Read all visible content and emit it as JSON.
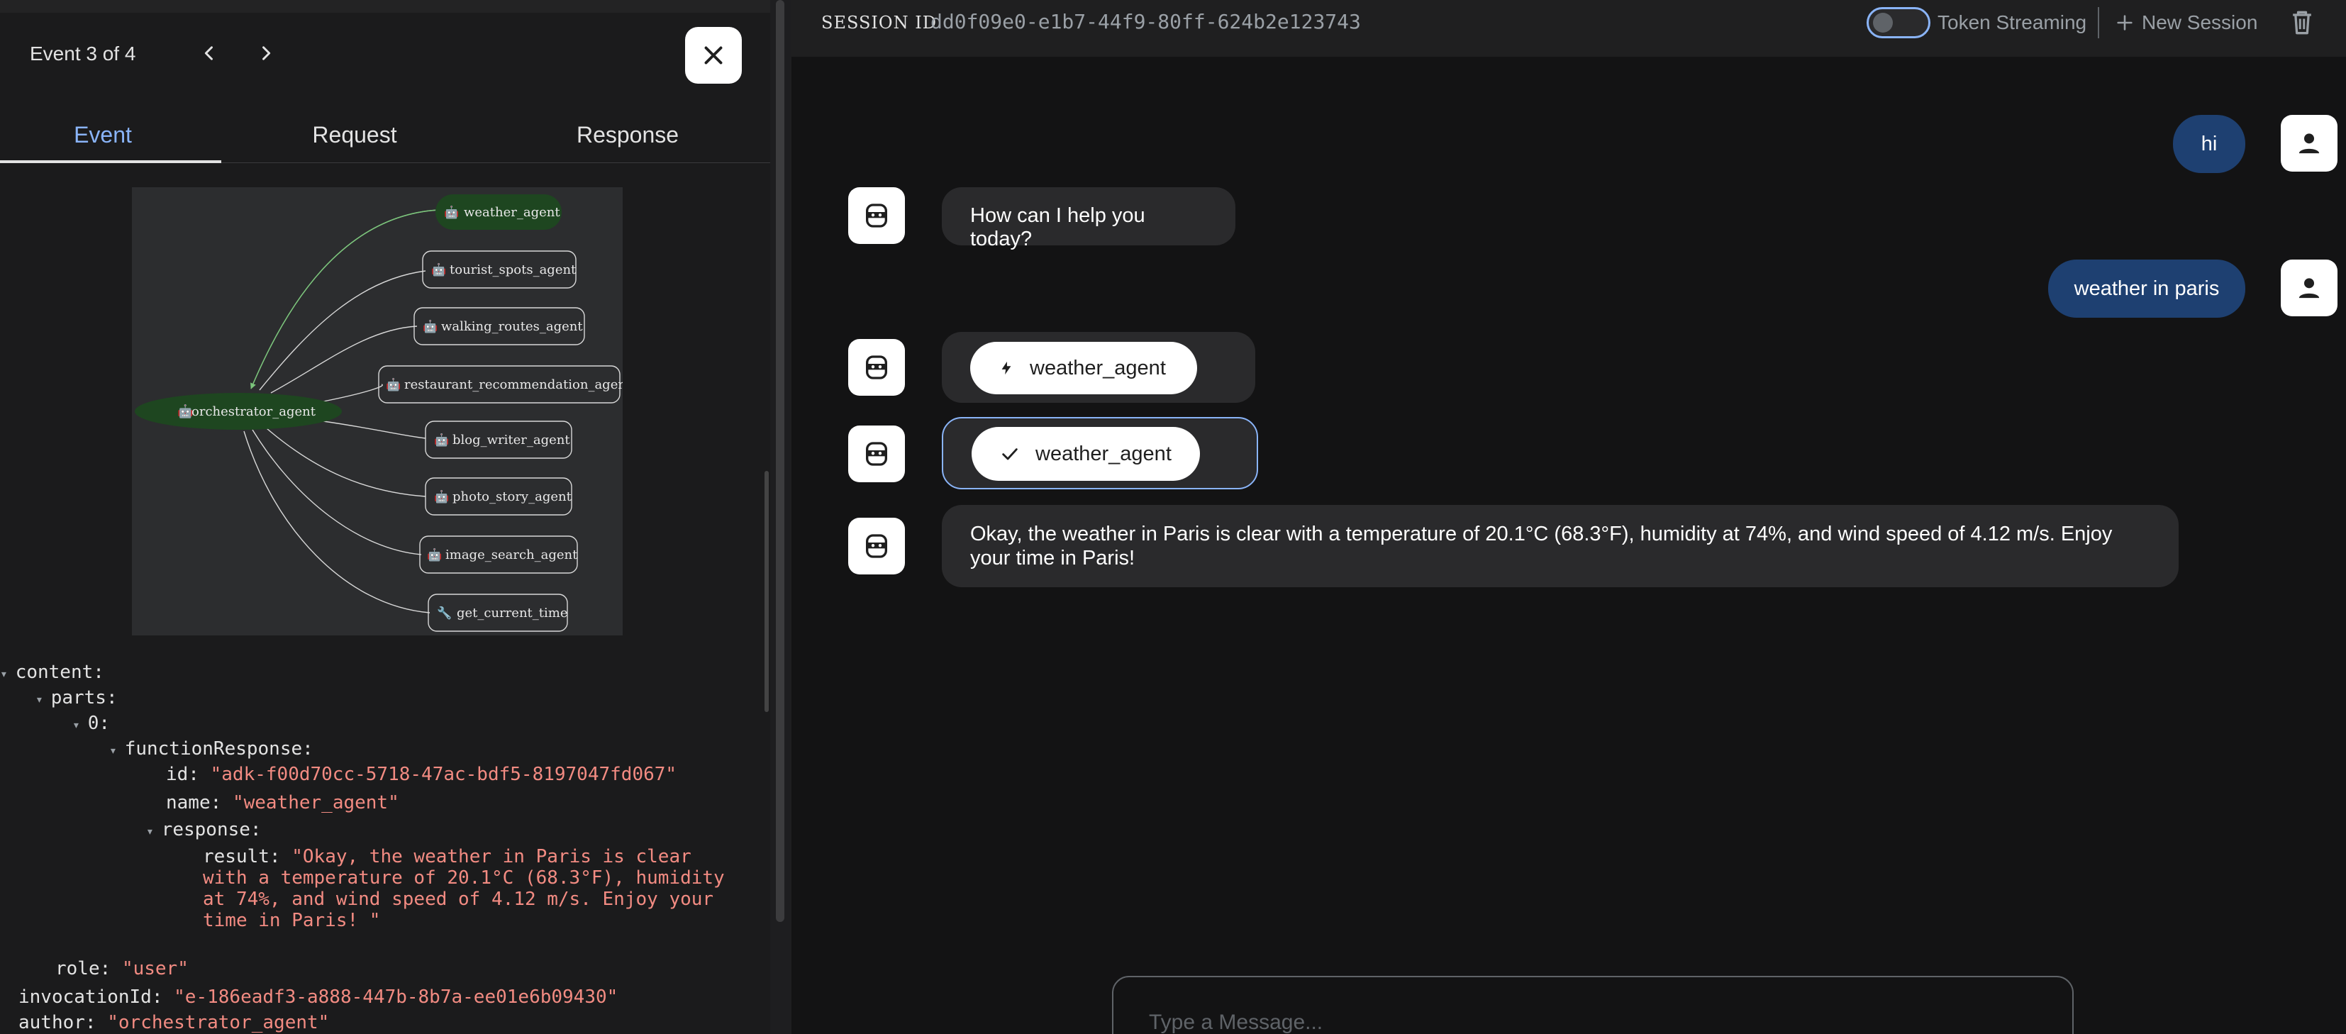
{
  "left_panel": {
    "event_title": "Event 3 of 4",
    "tabs": [
      {
        "label": "Event"
      },
      {
        "label": "Request"
      },
      {
        "label": "Response"
      }
    ],
    "graph": {
      "root": "orchestrator_agent",
      "nodes": [
        "weather_agent",
        "tourist_spots_agent",
        "walking_routes_agent",
        "restaurant_recommendation_agent",
        "blog_writer_agent",
        "photo_story_agent",
        "image_search_agent",
        "get_current_time"
      ],
      "active_node": "weather_agent"
    },
    "json": {
      "content_key": "content:",
      "parts_key": "parts:",
      "index_key": "0:",
      "function_response_key": "functionResponse:",
      "id_key": "id:",
      "id_val": "\"adk-f00d70cc-5718-47ac-bdf5-8197047fd067\"",
      "name_key": "name:",
      "name_val": "\"weather_agent\"",
      "response_key": "response:",
      "result_key": "result:",
      "result_lines": [
        "\"Okay, the weather in Paris is clear",
        "with a temperature of 20.1°C (68.3°F), humidity",
        "at 74%, and wind speed of 4.12 m/s. Enjoy your",
        "time in Paris! \""
      ],
      "role_key": "role:",
      "role_val": "\"user\"",
      "invocation_key": "invocationId:",
      "invocation_val": "\"e-186eadf3-a888-447b-8b7a-ee01e6b09430\"",
      "author_key": "author:",
      "author_val": "\"orchestrator_agent\""
    }
  },
  "header": {
    "session_label": "SESSION ID",
    "session_id": "dd0f09e0-e1b7-44f9-80ff-624b2e123743",
    "token_streaming": "Token Streaming",
    "new_session": "New Session"
  },
  "chat": {
    "messages": [
      {
        "role": "user",
        "text": "hi"
      },
      {
        "role": "bot",
        "text": "How can I help you today?"
      },
      {
        "role": "user",
        "text": "weather in paris"
      },
      {
        "role": "bot",
        "chip": "weather_agent",
        "icon": "bolt-icon"
      },
      {
        "role": "bot",
        "chip": "weather_agent",
        "icon": "check-icon"
      },
      {
        "role": "bot",
        "text": "Okay, the weather in Paris is clear with a temperature of 20.1°C (68.3°F), humidity at 74%, and wind speed of 4.12 m/s. Enjoy your time in Paris!"
      }
    ],
    "input_placeholder": "Type a Message..."
  },
  "colors": {
    "accent": "#8ab4f8",
    "user_bubble": "#1e4071",
    "json_string": "#f28b82",
    "graph_active": "#1e4620"
  }
}
